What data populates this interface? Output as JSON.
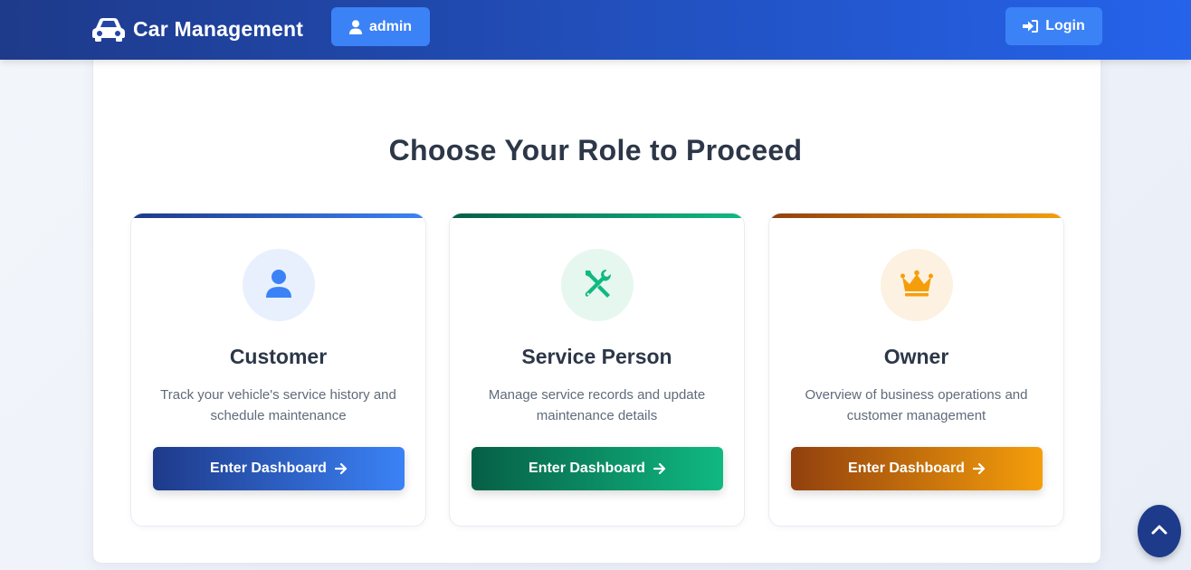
{
  "navbar": {
    "brand_text": "Car Management",
    "brand_icon": "car-icon",
    "user_label": "admin",
    "user_icon": "user-icon",
    "login_label": "Login",
    "login_icon": "sign-in-icon"
  },
  "main": {
    "title": "Choose Your Role to Proceed",
    "roles": [
      {
        "title": "Customer",
        "icon": "user-icon",
        "description": "Track your vehicle's service history and schedule maintenance",
        "button_label": "Enter Dashboard",
        "accent_from": "#1e3a8a",
        "accent_to": "#3b82f6"
      },
      {
        "title": "Service Person",
        "icon": "tools-icon",
        "description": "Manage service records and update maintenance details",
        "button_label": "Enter Dashboard",
        "accent_from": "#065f46",
        "accent_to": "#10b981"
      },
      {
        "title": "Owner",
        "icon": "crown-icon",
        "description": "Overview of business operations and customer management",
        "button_label": "Enter Dashboard",
        "accent_from": "#92400e",
        "accent_to": "#f59e0b"
      }
    ]
  },
  "scroll_top_icon": "chevron-up-icon",
  "colors": {
    "navbar_from": "#1e3a8a",
    "navbar_to": "#2563eb",
    "nav_button": "#3b82f6",
    "heading_text": "#2d3748"
  }
}
